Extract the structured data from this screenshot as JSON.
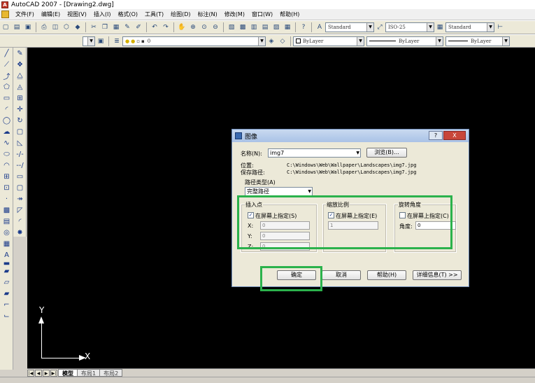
{
  "window": {
    "title": "AutoCAD 2007 - [Drawing2.dwg]",
    "icon": "autocad-logo-icon"
  },
  "menu": [
    "文件(F)",
    "编辑(E)",
    "视图(V)",
    "插入(I)",
    "格式(O)",
    "工具(T)",
    "绘图(D)",
    "标注(N)",
    "修改(M)",
    "窗口(W)",
    "帮助(H)"
  ],
  "toolbars": {
    "text_style": "Standard",
    "dim_style": "ISO-25",
    "table_style": "Standard",
    "layer": "0",
    "color": "ByLayer",
    "linetype": "ByLayer",
    "lineweight": "ByLayer"
  },
  "layout_tabs": [
    "模型",
    "布局1",
    "布局2"
  ],
  "ucs": {
    "x": "X",
    "y": "Y"
  },
  "dialog": {
    "title": "图像",
    "help_glyph": "?",
    "close_glyph": "X",
    "name_label": "名称(N):",
    "name_value": "img7",
    "browse_button": "浏览(B)...",
    "found_in_label": "位置:",
    "found_in_value": "C:\\Windows\\Web\\Wallpaper\\Landscapes\\img7.jpg",
    "saved_path_label": "保存路径:",
    "saved_path_value": "C:\\Windows\\Web\\Wallpaper\\Landscapes\\img7.jpg",
    "path_type_label": "路径类型(A)",
    "path_type_value": "完整路径",
    "insertion_point": {
      "title": "插入点",
      "specify_on_screen": "在屏幕上指定(S)",
      "checked": true,
      "x_label": "X:",
      "x_value": "0",
      "y_label": "Y:",
      "y_value": "0",
      "z_label": "Z:",
      "z_value": "0"
    },
    "scale": {
      "title": "缩放比例",
      "specify_on_screen": "在屏幕上指定(E)",
      "checked": true,
      "value": "1"
    },
    "rotation": {
      "title": "旋转角度",
      "specify_on_screen": "在屏幕上指定(C)",
      "checked": false,
      "angle_label": "角度:",
      "angle_value": "0"
    },
    "ok_button": "确定",
    "cancel_button": "取消",
    "help_button": "帮助(H)",
    "details_button": "详细信息(T) >>"
  },
  "colors": {
    "canvas": "#000000",
    "highlight": "#2bb24c",
    "dialog_bg": "#ece9d8"
  }
}
